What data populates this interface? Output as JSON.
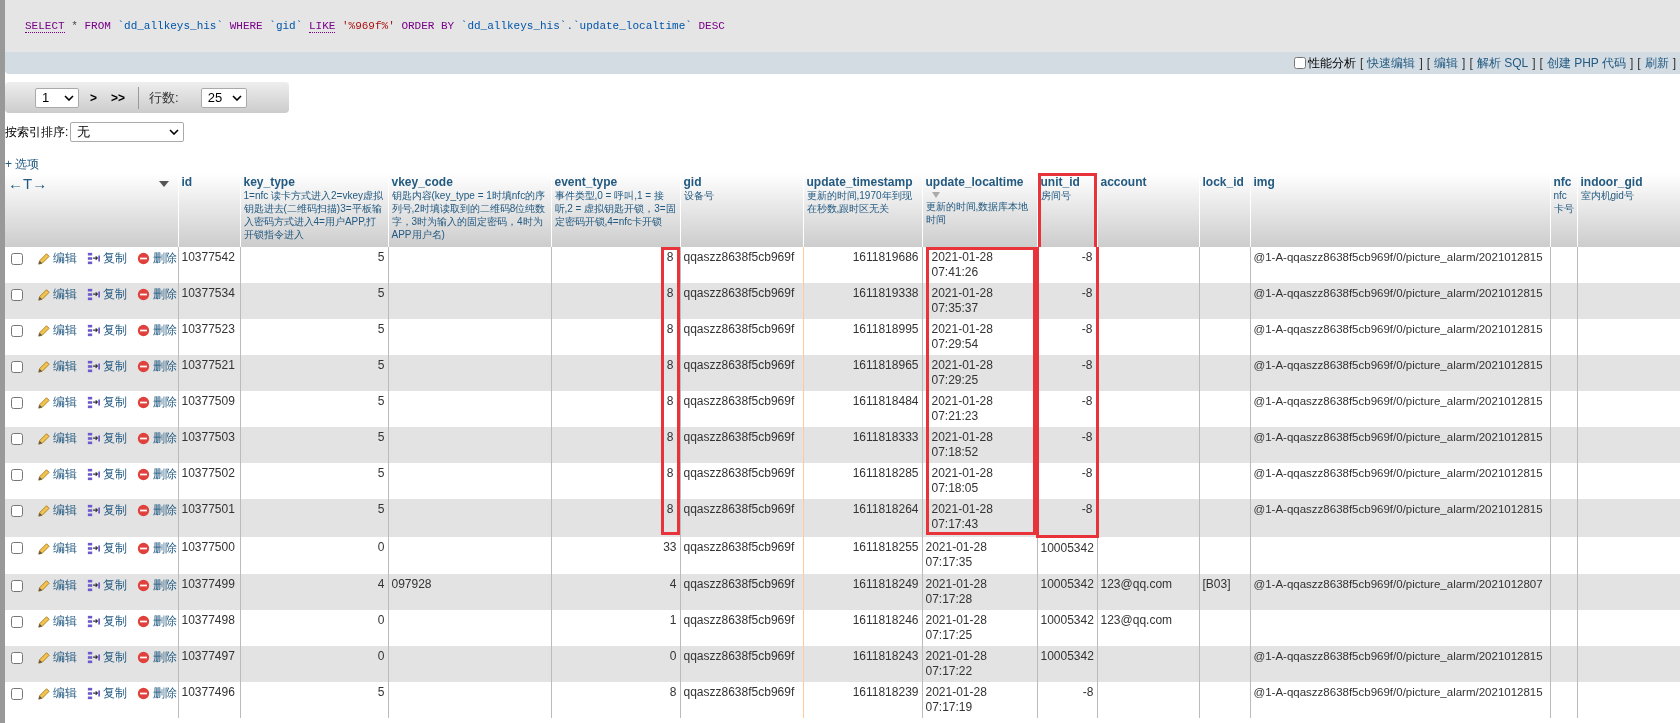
{
  "sql": {
    "tokens": [
      {
        "kind": "keyword-link",
        "text": "SELECT"
      },
      {
        "kind": "operator",
        "text": "*"
      },
      {
        "kind": "keyword",
        "text": "FROM"
      },
      {
        "kind": "identifier",
        "text": "`dd_allkeys_his`"
      },
      {
        "kind": "keyword",
        "text": "WHERE"
      },
      {
        "kind": "identifier",
        "text": "`gid`"
      },
      {
        "kind": "keyword-link",
        "text": "LIKE"
      },
      {
        "kind": "string",
        "text": "'%969f%'"
      },
      {
        "kind": "keyword",
        "text": "ORDER BY"
      },
      {
        "kind": "identifier",
        "text": "`dd_allkeys_his`.`update_localtime`"
      },
      {
        "kind": "keyword",
        "text": "DESC"
      }
    ]
  },
  "query_toolbar": {
    "profiling": {
      "label": "性能分析",
      "checked": false
    },
    "links": [
      {
        "before": "[",
        "label": "快速编辑",
        "after": "]"
      },
      {
        "before": "[",
        "label": "编辑",
        "after": "]"
      },
      {
        "before": "[",
        "label": "解析 SQL",
        "after": "]"
      },
      {
        "before": "[",
        "label": "创建 PHP 代码",
        "after": "]"
      },
      {
        "before": "[",
        "label": "刷新",
        "after": "]"
      }
    ]
  },
  "pagination": {
    "page": "1",
    "next": ">",
    "last": ">>",
    "rows_label": "行数:",
    "rows": "25"
  },
  "sort": {
    "label": "按索引排序:",
    "value": "无"
  },
  "options_link": "+ 选项",
  "table": {
    "header_arrows": "←T→",
    "columns": [
      {
        "title": "id",
        "kind": "text"
      },
      {
        "title": "key_type",
        "comment": "1=nfc 读卡方式进入2=vkey虚拟钥匙进去(二维码扫描)3=平板输入密码方式进入4=用户APP,打开锁指令进入",
        "kind": "number"
      },
      {
        "title": "vkey_code",
        "comment": "钥匙内容(key_type = 1时填nfc的序列号,2时填读取到的二维码8位纯数字，3时为输入的固定密码，4时为APP用户名)",
        "kind": "text"
      },
      {
        "title": "event_type",
        "comment": "事件类型,0 = 呼叫,1 = 接听,2 = 虚拟钥匙开锁，3=固定密码开锁,4=nfc卡开锁",
        "kind": "number",
        "boxed": true
      },
      {
        "title": "gid",
        "comment": "设备号",
        "kind": "text"
      },
      {
        "title": "update_timestamp",
        "comment": "更新的时间,1970年到现在秒数,跟时区无关",
        "kind": "number"
      },
      {
        "title": "update_localtime",
        "comment": "更新的时间,数据库本地时间",
        "kind": "text",
        "sorted": true,
        "boxed": true
      },
      {
        "title": "unit_id",
        "comment": "房间号",
        "kind": "number",
        "boxed": true,
        "boxed_header": true
      },
      {
        "title": "account",
        "kind": "text"
      },
      {
        "title": "lock_id",
        "kind": "text"
      },
      {
        "title": "img",
        "kind": "text"
      },
      {
        "title": "nfc",
        "comment": "nfc卡号",
        "kind": "text"
      },
      {
        "title": "indoor_gid",
        "comment": "室内机gid号",
        "kind": "text"
      }
    ],
    "rows": [
      {
        "checked": false,
        "highlighted": true,
        "actions": [
          "编辑",
          "复制",
          "删除"
        ],
        "cells": [
          "10377542",
          "5",
          "",
          "8",
          "qqaszz8638f5cb969f",
          "1611819686",
          "2021-01-28 07:41:26",
          "-8",
          "",
          "",
          "@1-A-qqaszz8638f5cb969f/0/picture_alarm/2021012815",
          "",
          ""
        ]
      },
      {
        "checked": false,
        "highlighted": true,
        "actions": [
          "编辑",
          "复制",
          "删除"
        ],
        "cells": [
          "10377534",
          "5",
          "",
          "8",
          "qqaszz8638f5cb969f",
          "1611819338",
          "2021-01-28 07:35:37",
          "-8",
          "",
          "",
          "@1-A-qqaszz8638f5cb969f/0/picture_alarm/2021012815",
          "",
          ""
        ]
      },
      {
        "checked": false,
        "highlighted": true,
        "actions": [
          "编辑",
          "复制",
          "删除"
        ],
        "cells": [
          "10377523",
          "5",
          "",
          "8",
          "qqaszz8638f5cb969f",
          "1611818995",
          "2021-01-28 07:29:54",
          "-8",
          "",
          "",
          "@1-A-qqaszz8638f5cb969f/0/picture_alarm/2021012815",
          "",
          ""
        ]
      },
      {
        "checked": false,
        "highlighted": true,
        "actions": [
          "编辑",
          "复制",
          "删除"
        ],
        "cells": [
          "10377521",
          "5",
          "",
          "8",
          "qqaszz8638f5cb969f",
          "1611818965",
          "2021-01-28 07:29:25",
          "-8",
          "",
          "",
          "@1-A-qqaszz8638f5cb969f/0/picture_alarm/2021012815",
          "",
          ""
        ]
      },
      {
        "checked": false,
        "highlighted": true,
        "actions": [
          "编辑",
          "复制",
          "删除"
        ],
        "cells": [
          "10377509",
          "5",
          "",
          "8",
          "qqaszz8638f5cb969f",
          "1611818484",
          "2021-01-28 07:21:23",
          "-8",
          "",
          "",
          "@1-A-qqaszz8638f5cb969f/0/picture_alarm/2021012815",
          "",
          ""
        ]
      },
      {
        "checked": false,
        "highlighted": true,
        "actions": [
          "编辑",
          "复制",
          "删除"
        ],
        "cells": [
          "10377503",
          "5",
          "",
          "8",
          "qqaszz8638f5cb969f",
          "1611818333",
          "2021-01-28 07:18:52",
          "-8",
          "",
          "",
          "@1-A-qqaszz8638f5cb969f/0/picture_alarm/2021012815",
          "",
          ""
        ]
      },
      {
        "checked": false,
        "highlighted": true,
        "actions": [
          "编辑",
          "复制",
          "删除"
        ],
        "cells": [
          "10377502",
          "5",
          "",
          "8",
          "qqaszz8638f5cb969f",
          "1611818285",
          "2021-01-28 07:18:05",
          "-8",
          "",
          "",
          "@1-A-qqaszz8638f5cb969f/0/picture_alarm/2021012815",
          "",
          ""
        ]
      },
      {
        "checked": false,
        "highlighted": true,
        "actions": [
          "编辑",
          "复制",
          "删除"
        ],
        "cells": [
          "10377501",
          "5",
          "",
          "8",
          "qqaszz8638f5cb969f",
          "1611818264",
          "2021-01-28 07:17:43",
          "-8",
          "",
          "",
          "@1-A-qqaszz8638f5cb969f/0/picture_alarm/2021012815",
          "",
          ""
        ]
      },
      {
        "checked": false,
        "highlighted": false,
        "actions": [
          "编辑",
          "复制",
          "删除"
        ],
        "cells": [
          "10377500",
          "0",
          "",
          "33",
          "qqaszz8638f5cb969f",
          "1611818255",
          "2021-01-28 07:17:35",
          "10005342",
          "",
          "",
          "",
          "",
          ""
        ]
      },
      {
        "checked": false,
        "highlighted": false,
        "actions": [
          "编辑",
          "复制",
          "删除"
        ],
        "cells": [
          "10377499",
          "4",
          "097928",
          "4",
          "qqaszz8638f5cb969f",
          "1611818249",
          "2021-01-28 07:17:28",
          "10005342",
          "123@qq.com",
          "[B03]",
          "@1-A-qqaszz8638f5cb969f/0/picture_alarm/2021012807",
          "",
          ""
        ]
      },
      {
        "checked": false,
        "highlighted": false,
        "actions": [
          "编辑",
          "复制",
          "删除"
        ],
        "cells": [
          "10377498",
          "0",
          "",
          "1",
          "qqaszz8638f5cb969f",
          "1611818246",
          "2021-01-28 07:17:25",
          "10005342",
          "123@qq.com",
          "",
          "",
          "",
          ""
        ]
      },
      {
        "checked": false,
        "highlighted": false,
        "actions": [
          "编辑",
          "复制",
          "删除"
        ],
        "cells": [
          "10377497",
          "0",
          "",
          "0",
          "qqaszz8638f5cb969f",
          "1611818243",
          "2021-01-28 07:17:22",
          "10005342",
          "",
          "",
          "@1-A-qqaszz8638f5cb969f/0/picture_alarm/2021012815",
          "",
          ""
        ]
      },
      {
        "checked": false,
        "highlighted": false,
        "actions": [
          "编辑",
          "复制",
          "删除"
        ],
        "cells": [
          "10377496",
          "5",
          "",
          "8",
          "qqaszz8638f5cb969f",
          "1611818239",
          "2021-01-28 07:17:19",
          "-8",
          "",
          "",
          "@1-A-qqaszz8638f5cb969f/0/picture_alarm/2021012815",
          "",
          ""
        ]
      }
    ]
  }
}
